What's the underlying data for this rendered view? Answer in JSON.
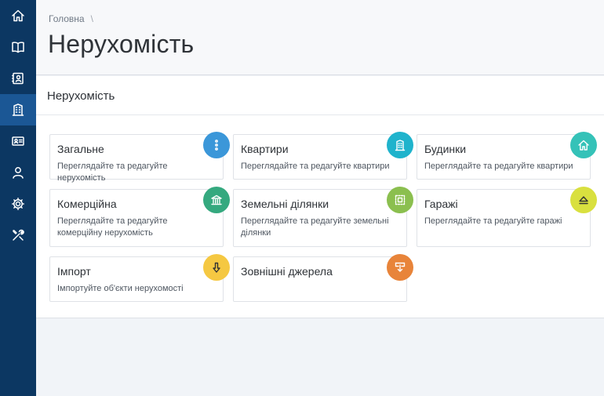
{
  "sidebar": {
    "items": [
      {
        "icon": "home-icon"
      },
      {
        "icon": "book-icon"
      },
      {
        "icon": "contact-book-icon"
      },
      {
        "icon": "building-icon",
        "active": true
      },
      {
        "icon": "id-card-icon"
      },
      {
        "icon": "user-icon"
      },
      {
        "icon": "gear-icon"
      },
      {
        "icon": "tools-icon"
      }
    ]
  },
  "header": {
    "breadcrumb": [
      "Головна"
    ],
    "breadcrumb_separator": "\\",
    "title": "Нерухомість"
  },
  "panel": {
    "title": "Нерухомість"
  },
  "cards": [
    {
      "title": "Загальне",
      "desc": "Переглядайте та редагуйте нерухомість",
      "icon": "more-vertical-icon",
      "color": "#3b97d9"
    },
    {
      "title": "Квартири",
      "desc": "Переглядайте та редагуйте квартири",
      "icon": "building-icon",
      "color": "#1fb3cc"
    },
    {
      "title": "Будинки",
      "desc": "Переглядайте та редагуйте квартири",
      "icon": "house-icon",
      "color": "#35c2b8"
    },
    {
      "title": "Комерційна",
      "desc": "Переглядайте та редагуйте комерційну нерухомість",
      "icon": "bank-icon",
      "color": "#35a97f"
    },
    {
      "title": "Земельні ділянки",
      "desc": "Переглядайте та редагуйте земельні ділянки",
      "icon": "land-plot-icon",
      "color": "#8bbf4f"
    },
    {
      "title": "Гаражі",
      "desc": "Переглядайте та редагуйте гаражі",
      "icon": "eject-icon",
      "color": "#d9e03f"
    },
    {
      "title": "Імпорт",
      "desc": "Імпортуйте об'єкти нерухомості",
      "icon": "arrow-down-icon",
      "color": "#f5c842"
    },
    {
      "title": "Зовнішні джерела",
      "desc": "",
      "icon": "external-import-icon",
      "color": "#e8843a"
    }
  ]
}
